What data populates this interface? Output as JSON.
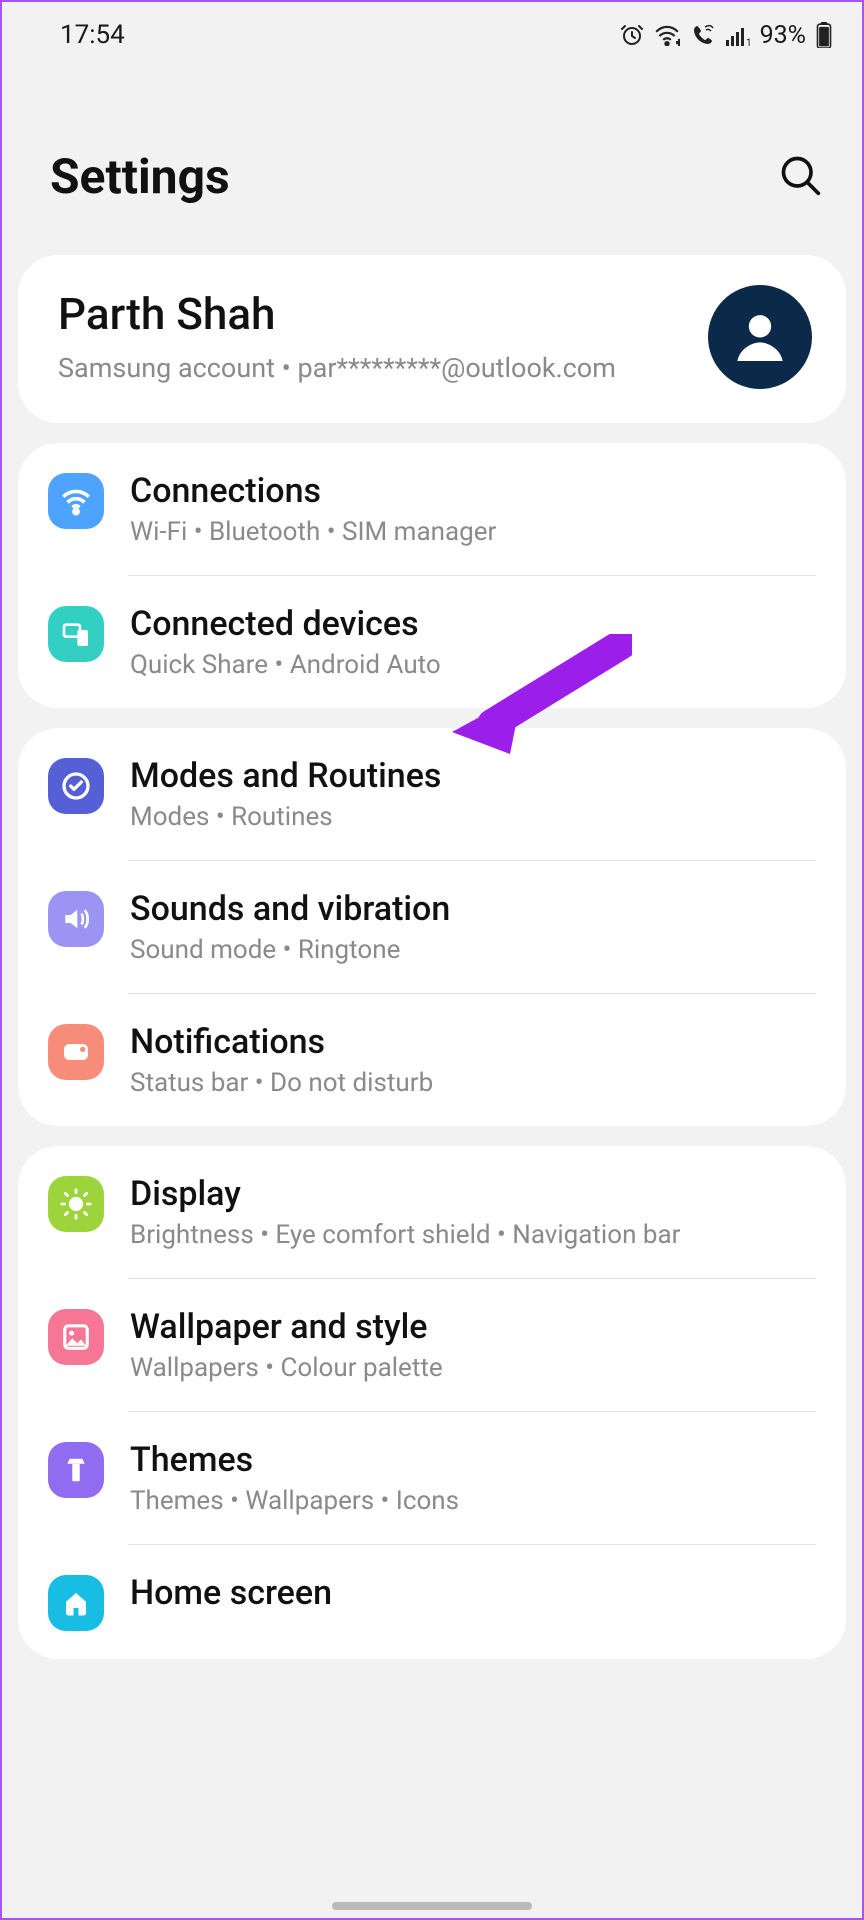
{
  "status": {
    "time": "17:54",
    "battery": "93%"
  },
  "page_title": "Settings",
  "account": {
    "name": "Parth Shah",
    "sub_prefix": "Samsung account",
    "email": "par*********@outlook.com"
  },
  "groups": [
    {
      "items": [
        {
          "icon": "wifi",
          "color": "bg-blue",
          "title": "Connections",
          "sub": [
            "Wi-Fi",
            "Bluetooth",
            "SIM manager"
          ]
        },
        {
          "icon": "devices",
          "color": "bg-teal",
          "title": "Connected devices",
          "sub": [
            "Quick Share",
            "Android Auto"
          ]
        }
      ]
    },
    {
      "items": [
        {
          "icon": "routines",
          "color": "bg-indigo",
          "title": "Modes and Routines",
          "sub": [
            "Modes",
            "Routines"
          ]
        },
        {
          "icon": "sound",
          "color": "bg-lilac",
          "title": "Sounds and vibration",
          "sub": [
            "Sound mode",
            "Ringtone"
          ]
        },
        {
          "icon": "notif",
          "color": "bg-coral",
          "title": "Notifications",
          "sub": [
            "Status bar",
            "Do not disturb"
          ]
        }
      ]
    },
    {
      "items": [
        {
          "icon": "display",
          "color": "bg-lime",
          "title": "Display",
          "sub": [
            "Brightness",
            "Eye comfort shield",
            "Navigation bar"
          ]
        },
        {
          "icon": "wall",
          "color": "bg-pink",
          "title": "Wallpaper and style",
          "sub": [
            "Wallpapers",
            "Colour palette"
          ]
        },
        {
          "icon": "themes",
          "color": "bg-purple",
          "title": "Themes",
          "sub": [
            "Themes",
            "Wallpapers",
            "Icons"
          ]
        },
        {
          "icon": "home",
          "color": "bg-cyan",
          "title": "Home screen",
          "sub": []
        }
      ]
    }
  ]
}
